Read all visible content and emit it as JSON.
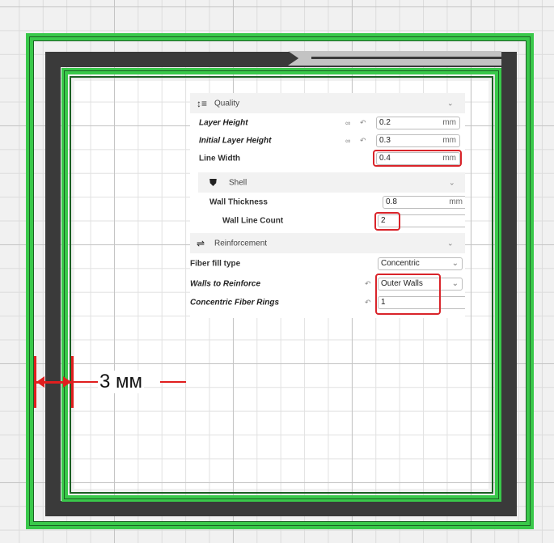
{
  "colors": {
    "filament": "#39c84a",
    "walls": "#3a3a3a",
    "highlight": "#d9242a"
  },
  "panel": {
    "quality": {
      "title": "Quality",
      "icon": "quality-list-icon"
    },
    "layer_height": {
      "label": "Layer Height",
      "value": "0.2",
      "unit": "mm"
    },
    "initial_layer_height": {
      "label": "Initial Layer Height",
      "value": "0.3",
      "unit": "mm"
    },
    "line_width": {
      "label": "Line Width",
      "value": "0.4",
      "unit": "mm"
    },
    "shell": {
      "title": "Shell",
      "icon": "shield-icon"
    },
    "wall_thickness": {
      "label": "Wall Thickness",
      "value": "0.8",
      "unit": "mm"
    },
    "wall_line_count": {
      "label": "Wall Line Count",
      "value": "2"
    },
    "reinforcement": {
      "title": "Reinforcement",
      "icon": "reinforcement-icon"
    },
    "fiber_fill_type": {
      "label": "Fiber fill type",
      "value": "Concentric"
    },
    "walls_to_reinforce": {
      "label": "Walls to Reinforce",
      "value": "Outer Walls"
    },
    "concentric_fiber_rings": {
      "label": "Concentric Fiber Rings",
      "value": "1"
    }
  },
  "annotation": {
    "dimension": "3 мм"
  }
}
